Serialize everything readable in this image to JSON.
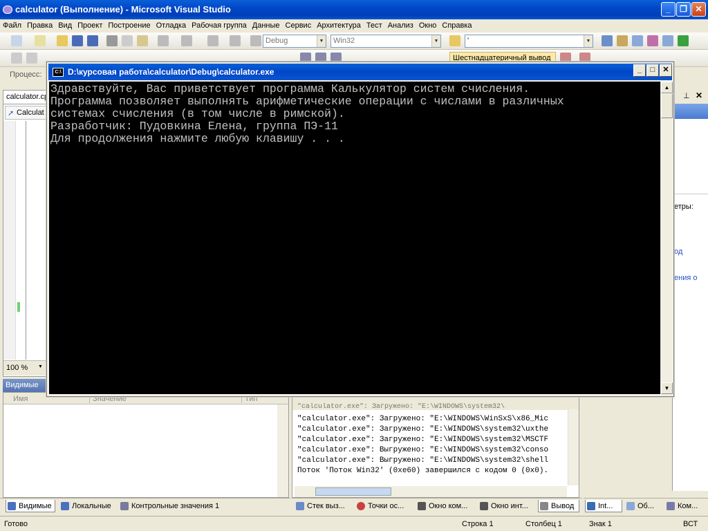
{
  "window": {
    "title": "calculator (Выполнение) - Microsoft Visual Studio"
  },
  "menu": [
    "Файл",
    "Правка",
    "Вид",
    "Проект",
    "Построение",
    "Отладка",
    "Рабочая группа",
    "Данные",
    "Сервис",
    "Архитектура",
    "Тест",
    "Анализ",
    "Окно",
    "Справка"
  ],
  "toolbar": {
    "config": "Debug",
    "platform": "Win32",
    "find_value": "'",
    "hex_output_label": "Шестнадцатеричный вывод"
  },
  "process_label": "Процесс:",
  "left_panel": {
    "tab": "calculator.cp",
    "nav_item": "Calculat",
    "zoom": "100 %"
  },
  "watch_panel": {
    "title": "Видимые",
    "columns": [
      "Имя",
      "Значение",
      "Тип"
    ]
  },
  "right_panel": {
    "text1": "етры:",
    "link1": "од",
    "link2": "ения о"
  },
  "console": {
    "title": "D:\\курсовая работа\\calculator\\Debug\\calculator.exe",
    "lines": [
      "Здравствуйте, Вас приветствует программа Калькулятор систем счисления.",
      "Программа позволяет выполнять арифметические операции с числами в различных",
      "системах счисления (в том числе в римской).",
      "Разработчик: Пудовкина Елена, группа ПЭ-11",
      "Для продолжения нажмите любую клавишу . . ."
    ]
  },
  "output_lines": [
    "\"calculator.exe\": Загружено: \"E:\\WINDOWS\\WinSxS\\x86_Mic",
    "\"calculator.exe\": Загружено: \"E:\\WINDOWS\\system32\\uxthe",
    "\"calculator.exe\": Загружено: \"E:\\WINDOWS\\system32\\MSCTF",
    "\"calculator.exe\": Выгружено: \"E:\\WINDOWS\\system32\\conso",
    "\"calculator.exe\": Выгружено: \"E:\\WINDOWS\\system32\\shell",
    "Поток 'Поток Win32' (0xe60) завершился с кодом 0 (0x0)."
  ],
  "bottom_tabs_left": [
    "Видимые",
    "Локальные",
    "Контрольные значения 1"
  ],
  "bottom_tabs_mid": [
    "Стек выз...",
    "Точки ос...",
    "Окно ком...",
    "Окно инт...",
    "Вывод"
  ],
  "bottom_tabs_right": [
    "Int...",
    "Об...",
    "Ком..."
  ],
  "status": {
    "ready": "Готово",
    "line": "Строка 1",
    "col": "Столбец 1",
    "char": "Знак 1",
    "mode": "ВСТ"
  },
  "colors": {
    "titlebar": "#0046c7",
    "console_bg": "#000000",
    "console_text": "#c0c0c0",
    "chrome": "#ece9d8"
  }
}
